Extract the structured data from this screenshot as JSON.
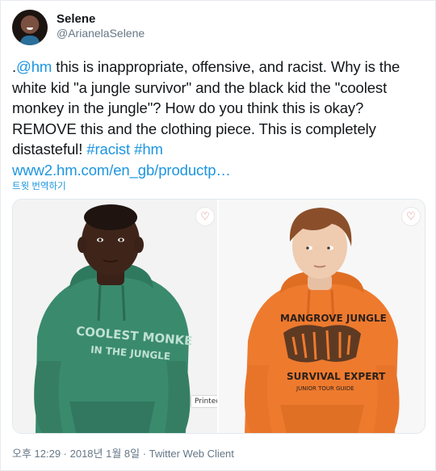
{
  "user": {
    "display_name": "Selene",
    "handle": "@ArianelaSelene"
  },
  "tweet": {
    "lead": ".",
    "mention": "@hm",
    "body": " this is inappropriate, offensive, and racist. Why is the white kid \"a jungle survivor\" and the black kid the \"coolest monkey in the jungle\"? How do you think this is okay? REMOVE this and the clothing piece. This is completely distasteful! ",
    "hashtag_1": "#racist",
    "hashtag_2": "#hm",
    "url": "www2.hm.com/en_gb/productp…",
    "translate_label": "트윗 번역하기"
  },
  "media": {
    "left": {
      "hoodie_line_1": "COOLEST MONKE",
      "hoodie_line_2": "IN THE JUNGLE",
      "badge": "Printed"
    },
    "right": {
      "hoodie_line_1": "MANGROVE JUNGLE",
      "hoodie_line_2": "SURVIVAL EXPERT",
      "hoodie_line_3": "JUNIOR TOUR GUIDE"
    },
    "favorite_icon": "heart-icon"
  },
  "meta": {
    "timestamp": "오후 12:29 · 2018년 1월 8일 · Twitter Web Client"
  },
  "colors": {
    "link": "#1b95e0",
    "green_hoodie": "#3a8a6e",
    "orange_hoodie": "#ee7a2e"
  }
}
